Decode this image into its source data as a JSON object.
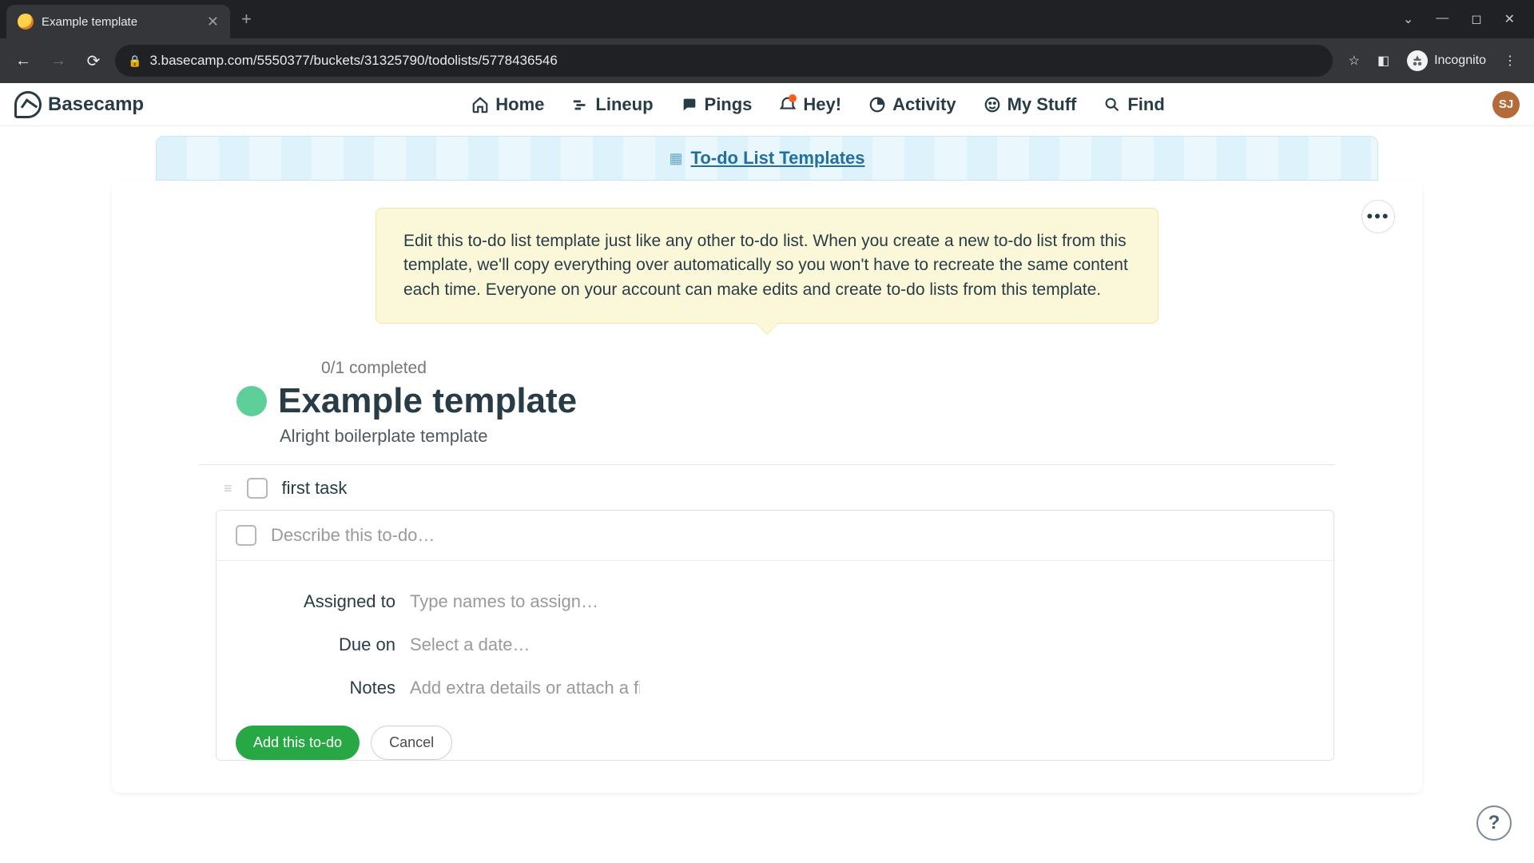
{
  "browser": {
    "tab_title": "Example template",
    "url": "3.basecamp.com/5550377/buckets/31325790/todolists/5778436546",
    "incognito_label": "Incognito"
  },
  "nav": {
    "logo_text": "Basecamp",
    "items": {
      "home": "Home",
      "lineup": "Lineup",
      "pings": "Pings",
      "hey": "Hey!",
      "activity": "Activity",
      "mystuff": "My Stuff",
      "find": "Find"
    },
    "avatar_initials": "SJ"
  },
  "breadcrumb": {
    "label": "To-do List Templates"
  },
  "callout": {
    "text": "Edit this to-do list template just like any other to-do list. When you create a new to-do list from this template, we'll copy everything over automatically so you won't have to recreate the same content each time. Everyone on your account can make edits and create to-do lists from this template."
  },
  "list": {
    "progress": "0/1 completed",
    "title": "Example template",
    "description": "Alright boilerplate template"
  },
  "tasks": [
    {
      "label": "first task"
    }
  ],
  "new_task": {
    "placeholder": "Describe this to-do…",
    "fields": {
      "assigned_label": "Assigned to",
      "assigned_placeholder": "Type names to assign…",
      "due_label": "Due on",
      "due_placeholder": "Select a date…",
      "notes_label": "Notes",
      "notes_placeholder": "Add extra details or attach a file…"
    },
    "submit": "Add this to-do",
    "cancel": "Cancel"
  },
  "help": "?"
}
